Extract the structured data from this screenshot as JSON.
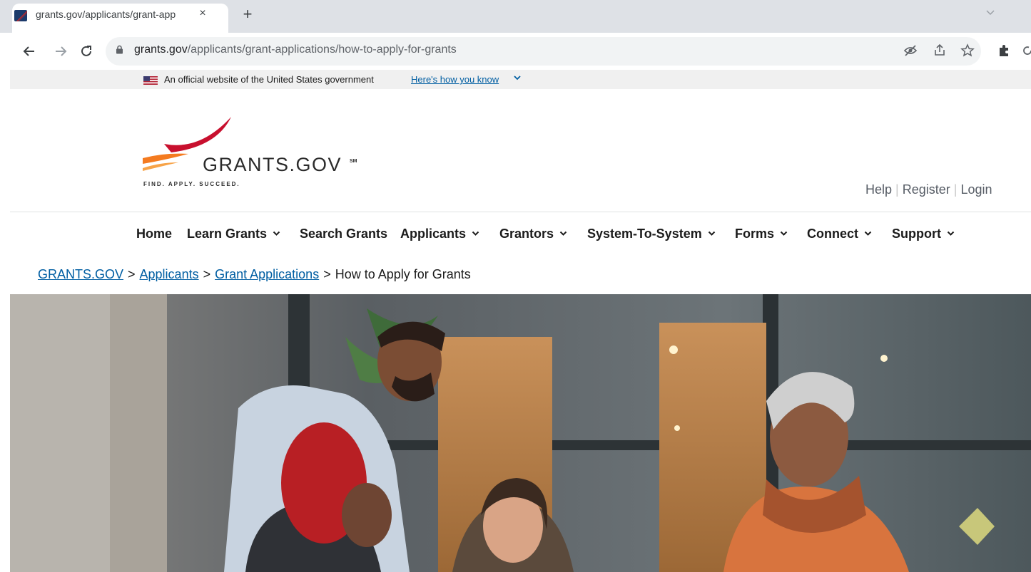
{
  "browser": {
    "tab_title": "grants.gov/applicants/grant-app",
    "tab_close": "×",
    "new_tab": "+",
    "url_host": "grants.gov",
    "url_path": "/applicants/grant-applications/how-to-apply-for-grants",
    "icons": [
      "back-arrow-icon",
      "forward-arrow-icon",
      "reload-icon",
      "lock-icon",
      "eye-slash-icon",
      "share-icon",
      "star-icon",
      "extensions-icon",
      "refresh-icon"
    ]
  },
  "gov_banner": {
    "text": "An official website of the United States government",
    "link": "Here's how you know",
    "chevron": "⌄"
  },
  "header": {
    "logo_wordmark": "GRANTS.GOV",
    "logo_sm": "SM",
    "logo_tagline": "FIND. APPLY. SUCCEED.",
    "util_links": [
      "Help",
      "Register",
      "Login"
    ]
  },
  "nav": {
    "items": [
      {
        "label": "Home",
        "dropdown": false
      },
      {
        "label": "Learn Grants",
        "dropdown": true
      },
      {
        "label": "Search Grants",
        "dropdown": false
      },
      {
        "label": "Applicants",
        "dropdown": true
      },
      {
        "label": "Grantors",
        "dropdown": true
      },
      {
        "label": "System-To-System",
        "dropdown": true
      },
      {
        "label": "Forms",
        "dropdown": true
      },
      {
        "label": "Connect",
        "dropdown": true
      },
      {
        "label": "Support",
        "dropdown": true
      }
    ],
    "chevron": "⌄"
  },
  "breadcrumb": {
    "items": [
      "GRANTS.GOV",
      "Applicants",
      "Grant Applications"
    ],
    "current": "How to Apply for Grants",
    "separator": ">"
  },
  "colors": {
    "link": "#005ea2",
    "logo_red": "#c8102e",
    "logo_orange": "#f47b20"
  }
}
